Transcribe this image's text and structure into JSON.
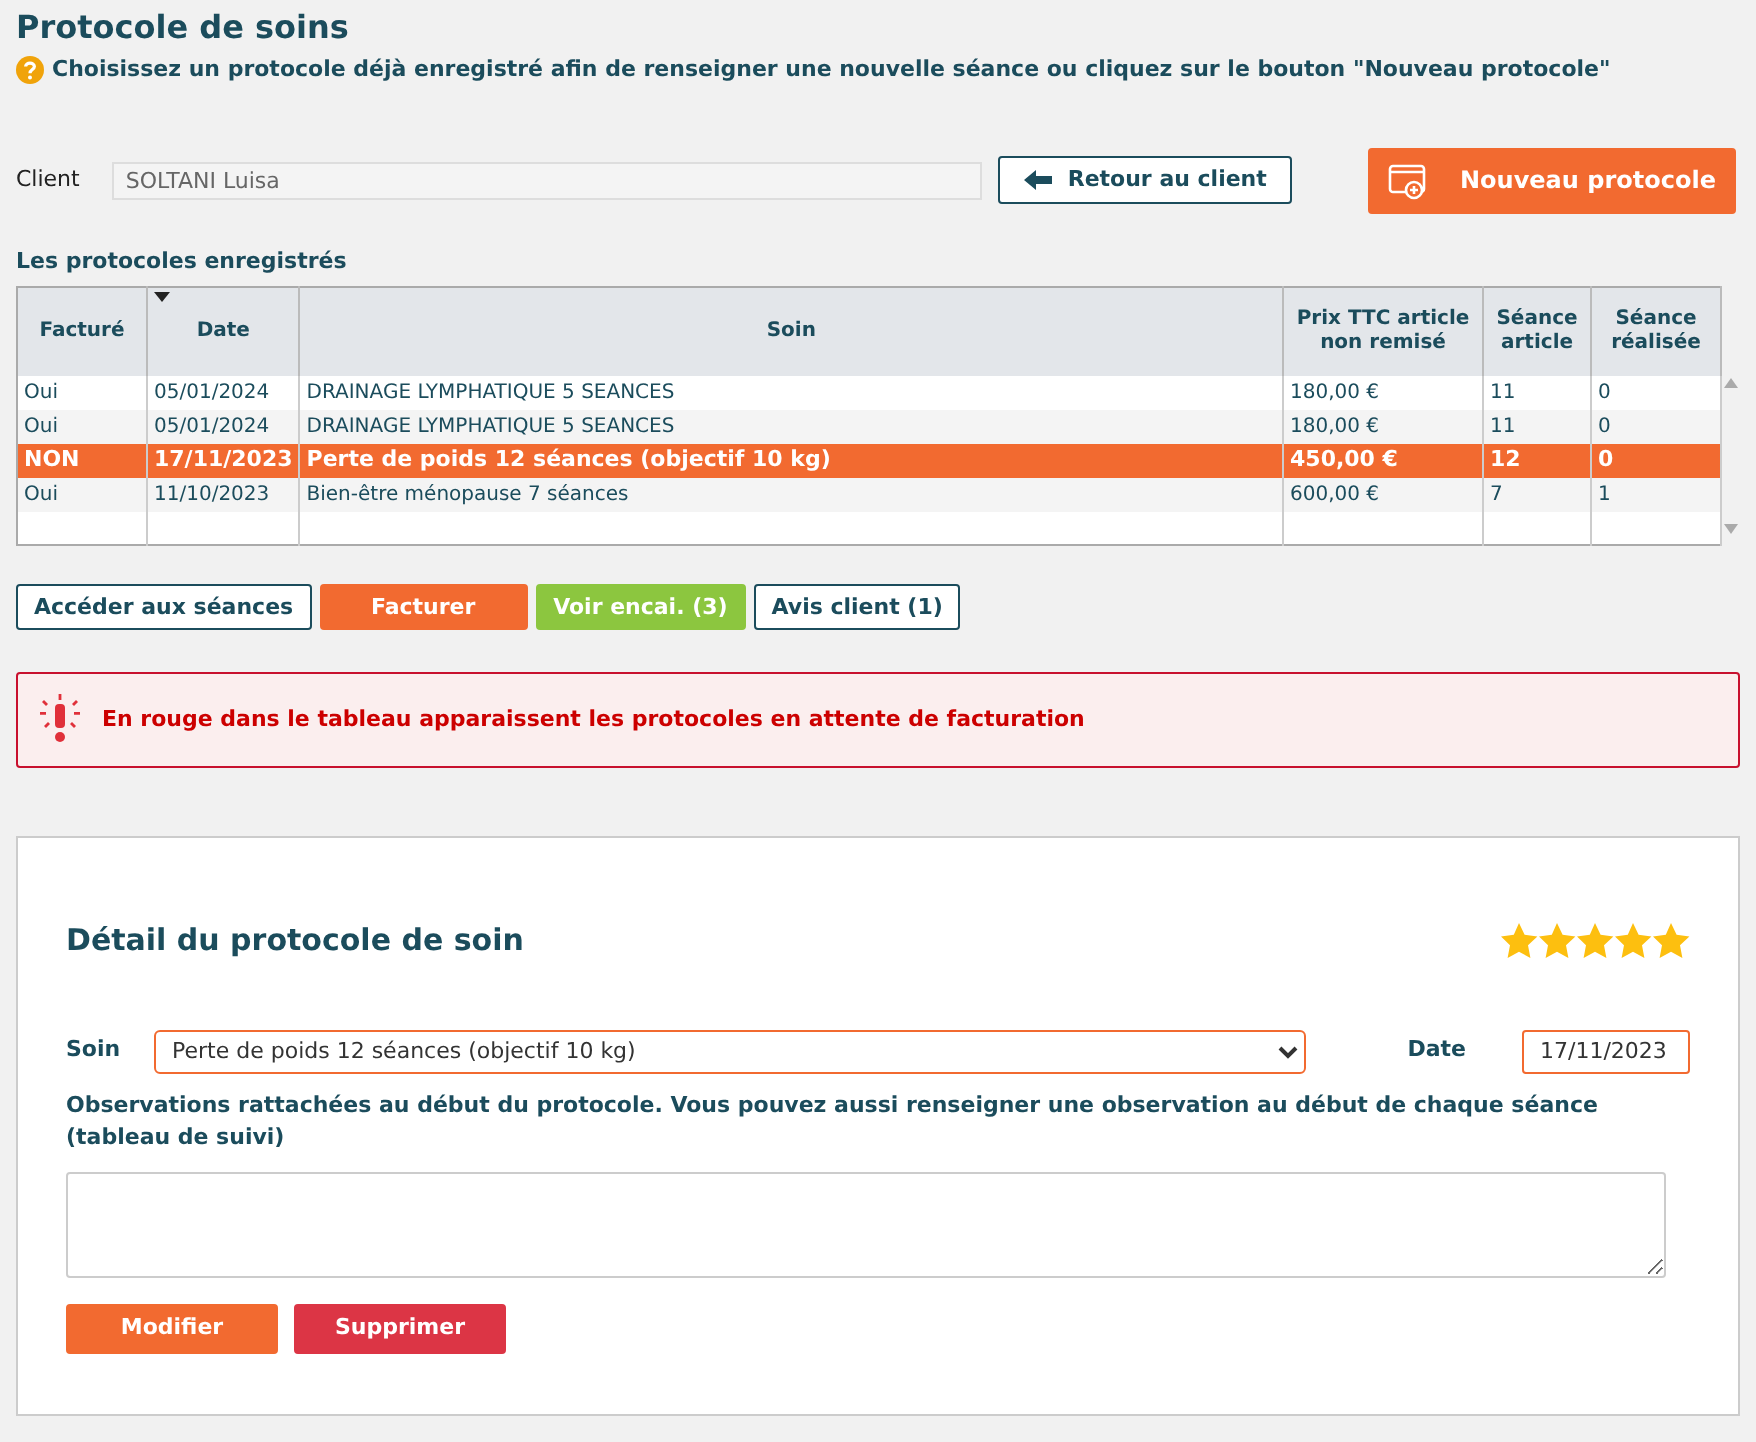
{
  "page_title": "Protocole de soins",
  "help_text": "Choisissez un protocole déjà enregistré afin de renseigner une nouvelle séance ou cliquez sur le bouton \"Nouveau protocole\"",
  "client": {
    "label": "Client",
    "value": "SOLTANI Luisa"
  },
  "back_button": "Retour au client",
  "new_button": "Nouveau protocole",
  "table": {
    "title": "Les protocoles enregistrés",
    "columns": [
      {
        "label": "Facturé",
        "sorted": false
      },
      {
        "label": "Date",
        "sorted": true
      },
      {
        "label": "Soin",
        "sorted": false
      },
      {
        "label": "Prix TTC article non remisé",
        "sorted": false
      },
      {
        "label": "Séance article",
        "sorted": false
      },
      {
        "label": "Séance réalisée",
        "sorted": false
      }
    ],
    "rows": [
      {
        "cells": [
          "Oui",
          "05/01/2024",
          "DRAINAGE LYMPHATIQUE 5 SEANCES",
          "180,00 €",
          "11",
          "0"
        ],
        "selected": false
      },
      {
        "cells": [
          "Oui",
          "05/01/2024",
          "DRAINAGE LYMPHATIQUE 5 SEANCES",
          "180,00 €",
          "11",
          "0"
        ],
        "selected": false
      },
      {
        "cells": [
          "NON",
          "17/11/2023",
          "Perte de poids 12 séances (objectif 10 kg)",
          "450,00 €",
          "12",
          "0"
        ],
        "selected": true
      },
      {
        "cells": [
          "Oui",
          "11/10/2023",
          "Bien-être ménopause 7 séances",
          "600,00 €",
          "7",
          "1"
        ],
        "selected": false
      }
    ]
  },
  "actions": [
    {
      "label": "Accéder aux séances",
      "kind": "outline"
    },
    {
      "label": "Facturer",
      "kind": "orange"
    },
    {
      "label": "Voir encai. (3)",
      "kind": "green"
    },
    {
      "label": "Avis client (1)",
      "kind": "outline"
    }
  ],
  "alert": "En rouge dans le tableau apparaissent les protocoles en attente de facturation",
  "detail": {
    "title": "Détail du protocole de soin",
    "stars": 5,
    "soin_label": "Soin",
    "soin_value": "Perte de poids 12 séances (objectif 10 kg)",
    "date_label": "Date",
    "date_value": "17/11/2023",
    "obs_label": "Observations rattachées au début du protocole. Vous pouvez aussi renseigner une observation au début de chaque séance (tableau de suivi)",
    "buttons": [
      {
        "label": "Modifier",
        "kind": "orange"
      },
      {
        "label": "Supprimer",
        "kind": "red"
      }
    ]
  }
}
